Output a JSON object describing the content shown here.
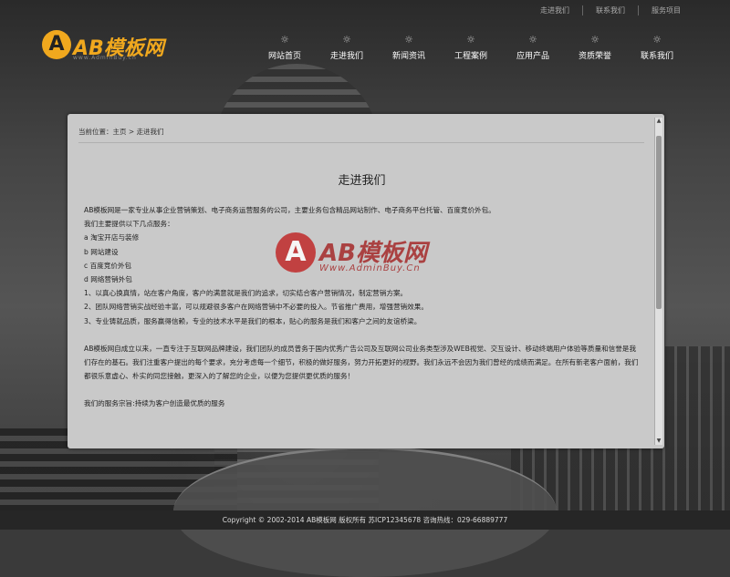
{
  "toplinks": [
    "走进我们",
    "联系我们",
    "服务项目"
  ],
  "logo": {
    "mark": "A",
    "name": "AB模板网",
    "sub": "www.AdminBuy.cn"
  },
  "nav": [
    {
      "label": "网站首页",
      "icon": "sun-icon"
    },
    {
      "label": "走进我们",
      "icon": "sun-icon"
    },
    {
      "label": "新闻资讯",
      "icon": "sun-icon"
    },
    {
      "label": "工程案例",
      "icon": "sun-icon"
    },
    {
      "label": "应用产品",
      "icon": "sun-icon"
    },
    {
      "label": "资质荣誉",
      "icon": "sun-icon"
    },
    {
      "label": "联系我们",
      "icon": "sun-icon"
    }
  ],
  "breadcrumb": {
    "prefix": "当前位置：",
    "home": "主页",
    "sep": " > ",
    "current": "走进我们"
  },
  "page_title": "走进我们",
  "article": {
    "lines": [
      "AB模板网是一家专业从事企业营销策划、电子商务运营服务的公司，主要业务包含精品网站制作、电子商务平台托管、百度竞价外包。",
      "我们主要提供以下几点服务：",
      "a  淘宝开店与装修",
      "b  网站建设",
      "c  百度竞价外包",
      "d  网络营销外包",
      "1、以真心换真情，站在客户角度，客户的满意就是我们的追求，切实结合客户营销情况，制定营销方案。",
      "2、团队网络营销实战经验丰富，可以规避很多客户在网络营销中不必要的投入。节省推广费用，增强营销效果。",
      "3、专业铸就品质，服务赢得信赖，专业的技术水平是我们的根本，贴心的服务是我们和客户之间的友谊桥梁。"
    ],
    "paragraph2": "AB模板网自成立以来，一直专注于互联网品牌建设，我们团队的成员曾务于国内优秀广告公司及互联网公司业务类型涉及WEB视觉、交互设计、移动终端用户体验等质量和信誉是我们存在的基石。我们注重客户提出的每个要求，充分考虑每一个细节，积极的做好服务，努力开拓更好的视野。我们永远不会因为我们曾经的成绩而满足。在所有新老客户面前，我们都很乐意虚心、朴实的同您接触，更深入的了解您的企业，以便为您提供更优质的服务！",
    "slogan": "我们的服务宗旨:持续为客户创造最优质的服务"
  },
  "watermark": {
    "mark": "A",
    "name": "AB模板网",
    "url": "Www.AdminBuy.Cn"
  },
  "footer": "Copyright © 2002-2014 AB模板网 版权所有 苏ICP12345678 咨询热线：029-66889777"
}
